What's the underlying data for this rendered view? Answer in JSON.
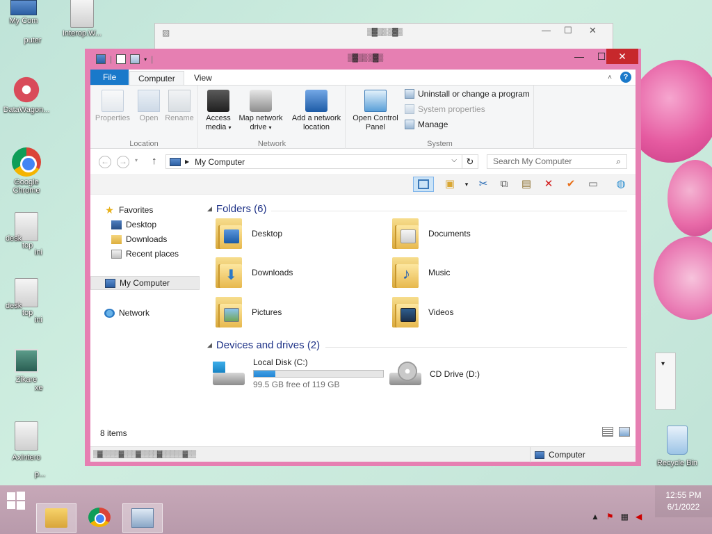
{
  "desktop": {
    "icons": [
      {
        "label": "My Com"
      },
      {
        "label": "puter"
      },
      {
        "label": "Interop.W..."
      },
      {
        "label": "DataWagon..."
      },
      {
        "label": "Google Chrome"
      },
      {
        "label": "desk"
      },
      {
        "label": "top"
      },
      {
        "label": "ini"
      },
      {
        "label": "desk"
      },
      {
        "label": "top"
      },
      {
        "label": "ini"
      },
      {
        "label": "Zikare"
      },
      {
        "label": "xe"
      },
      {
        "label": "AxIntero"
      },
      {
        "label": "p..."
      },
      {
        "label": "Recycle Bin"
      }
    ]
  },
  "explorer": {
    "tabs": {
      "file": "File",
      "computer": "Computer",
      "view": "View"
    },
    "ribbon": {
      "location": {
        "label": "Location",
        "properties": "Properties",
        "open": "Open",
        "rename": "Rename"
      },
      "network": {
        "label": "Network",
        "access_media_1": "Access",
        "access_media_2": "media",
        "map_drive_1": "Map network",
        "map_drive_2": "drive",
        "add_location_1": "Add a network",
        "add_location_2": "location"
      },
      "system": {
        "label": "System",
        "control_panel_1": "Open Control",
        "control_panel_2": "Panel",
        "uninstall": "Uninstall or change a program",
        "system_properties": "System properties",
        "manage": "Manage"
      }
    },
    "address": {
      "path": "My Computer",
      "search_placeholder": "Search My Computer"
    },
    "nav": {
      "favorites": "Favorites",
      "desktop": "Desktop",
      "downloads": "Downloads",
      "recent": "Recent places",
      "my_computer": "My Computer",
      "network": "Network"
    },
    "folders": {
      "header": "Folders (6)",
      "items": [
        {
          "name": "Desktop"
        },
        {
          "name": "Documents"
        },
        {
          "name": "Downloads"
        },
        {
          "name": "Music"
        },
        {
          "name": "Pictures"
        },
        {
          "name": "Videos"
        }
      ]
    },
    "devices": {
      "header": "Devices and drives (2)",
      "local": {
        "name": "Local Disk (C:)",
        "free": "99.5 GB free of 119 GB",
        "used_fraction": 0.164
      },
      "cd": {
        "name": "CD Drive (D:)"
      }
    },
    "status": {
      "count": "8 items",
      "location": "Computer"
    }
  },
  "taskbar": {
    "time": "12:55 PM",
    "date": "6/1/2022"
  },
  "colors": {
    "window_frame": "#e67fb2",
    "file_tab": "#1979ca",
    "close_button": "#c7282c",
    "progress": "#2386d5"
  }
}
